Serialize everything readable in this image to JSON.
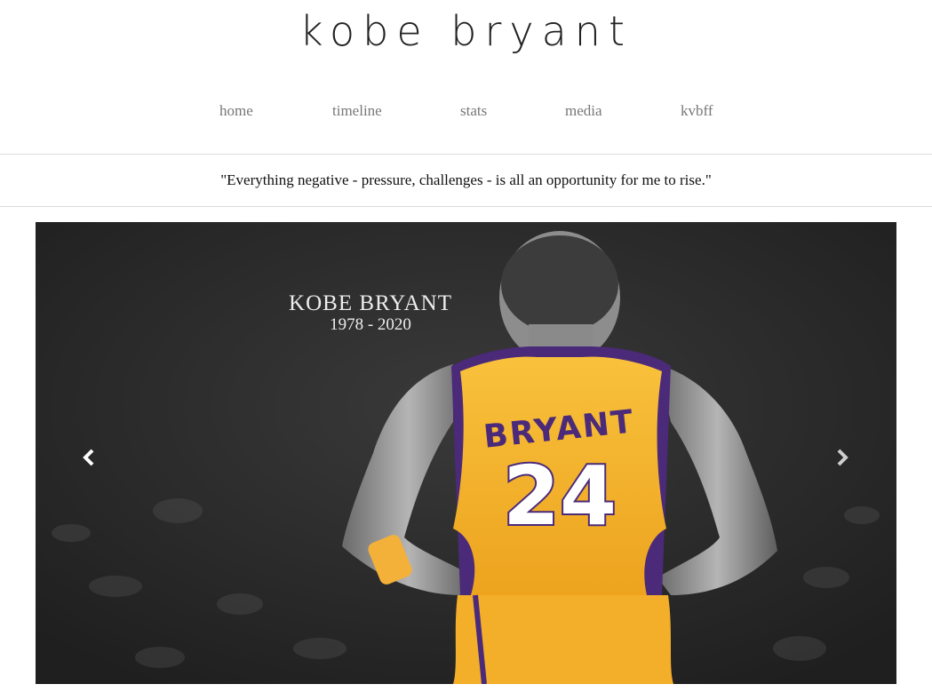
{
  "site": {
    "title": "kobe bryant"
  },
  "nav": {
    "items": [
      {
        "label": "home"
      },
      {
        "label": "timeline"
      },
      {
        "label": "stats"
      },
      {
        "label": "media"
      },
      {
        "label": "kvbff"
      }
    ]
  },
  "quote": {
    "text": "\"Everything negative - pressure, challenges - is all an opportunity for me to rise.\""
  },
  "carousel": {
    "overlay_name": "KOBE BRYANT",
    "overlay_years": "1978 - 2020",
    "jersey_name": "BRYANT",
    "jersey_number": "24",
    "prev_icon": "chevron-left-icon",
    "next_icon": "chevron-right-icon"
  },
  "colors": {
    "jersey_gold": "#f6b42b",
    "jersey_purple": "#4b2a7a",
    "slide_background": "#2a2a2a"
  }
}
